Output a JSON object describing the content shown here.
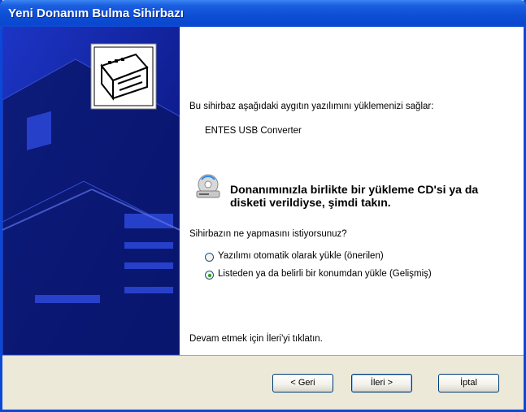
{
  "window": {
    "title": "Yeni Donanım Bulma Sihirbazı"
  },
  "main": {
    "intro": "Bu sihirbaz aşağıdaki aygıtın yazılımını yüklemenizi sağlar:",
    "device_name": "ENTES USB Converter",
    "cd_notice": "Donanımınızla birlikte bir yükleme CD'si ya da disketi verildiyse, şimdi takın.",
    "question": "Sihirbazın ne yapmasını istiyorsunuz?",
    "options": [
      {
        "label": "Yazılımı otomatik olarak yükle (önerilen)",
        "selected": false
      },
      {
        "label": "Listeden ya da belirli bir konumdan yükle (Gelişmiş)",
        "selected": true
      }
    ],
    "continue_hint": "Devam etmek için İleri'yi tıklatın."
  },
  "buttons": {
    "back": "< Geri",
    "next": "İleri >",
    "cancel": "İptal"
  },
  "icons": {
    "wizard": "hardware-card-icon",
    "cd": "cd-drive-icon"
  }
}
